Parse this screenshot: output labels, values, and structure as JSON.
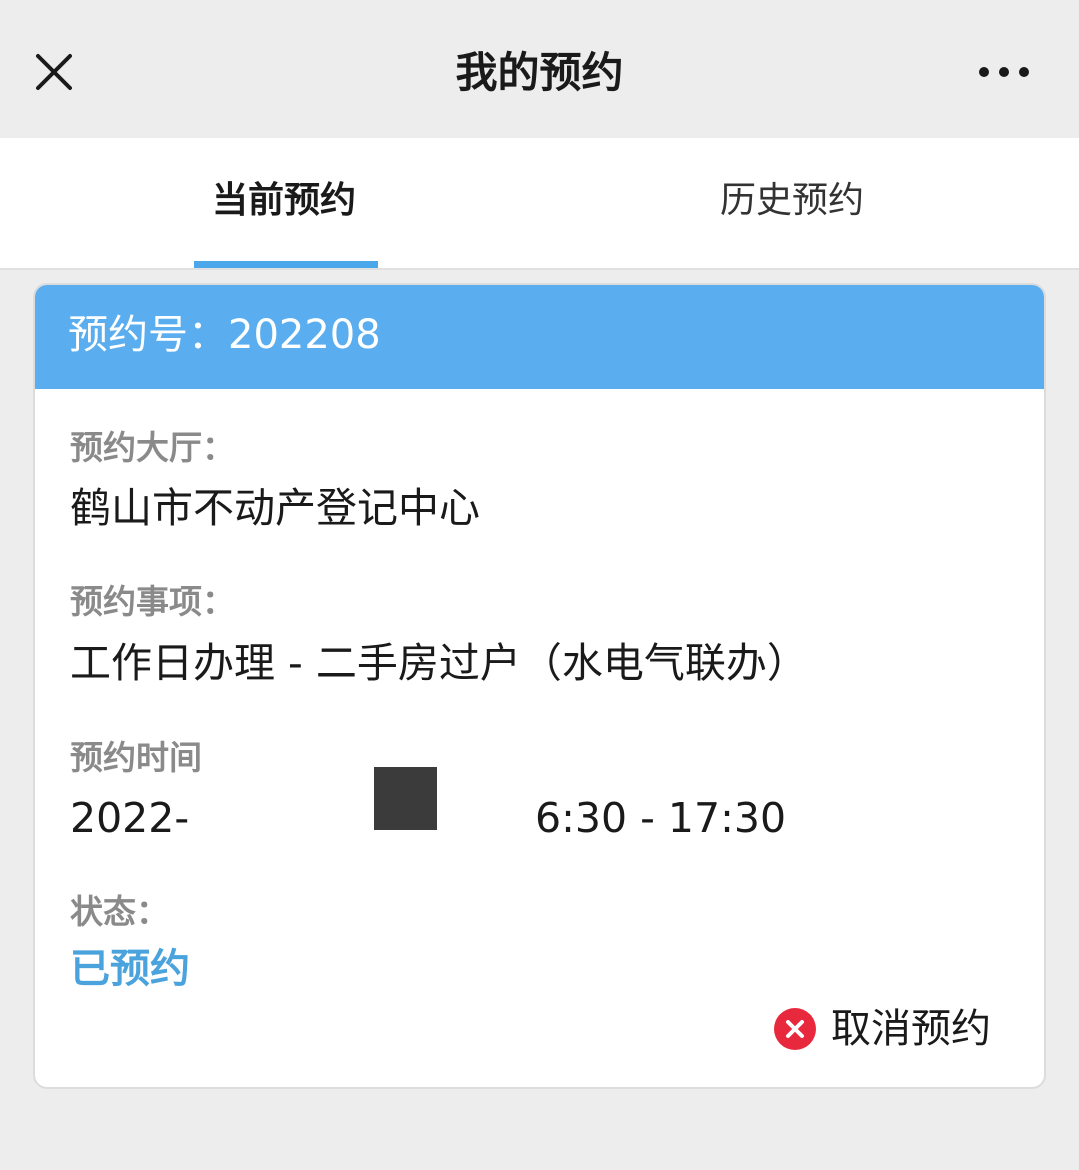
{
  "topbar": {
    "title": "我的预约",
    "close_icon": "close-icon",
    "more_icon": "more-dots-icon"
  },
  "tabs": [
    {
      "label": "当前预约",
      "active": true
    },
    {
      "label": "历史预约",
      "active": false
    }
  ],
  "card": {
    "header_label": "预约号：202208",
    "fields": [
      {
        "label": "预约大厅：",
        "value": "鹤山市不动产登记中心"
      },
      {
        "label": "预约事项：",
        "value": "工作日办理 - 二手房过户（水电气联办）"
      },
      {
        "label": "预约时间",
        "value_start": "2022-",
        "value_end": "6:30 - 17:30"
      },
      {
        "label": "状态：",
        "value": "已预约"
      }
    ],
    "cancel_label": "取消预约",
    "cancel_icon": "cancel-x-circle-icon"
  },
  "colors": {
    "accent": "#5aaeef",
    "tab_indicator": "#4aa8ea",
    "status": "#4aa3dc",
    "cancel_icon": "#e8283c",
    "background": "#ededed"
  }
}
